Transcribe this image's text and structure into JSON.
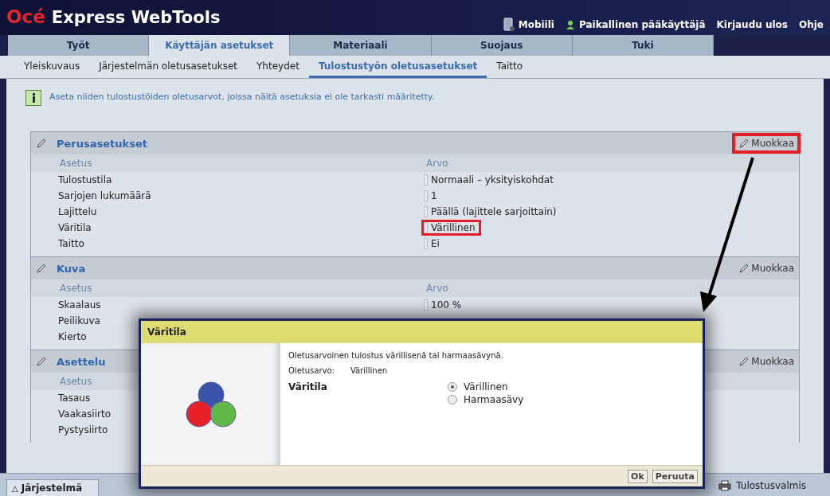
{
  "header": {
    "logo_brand": "Océ",
    "logo_product": "Express WebTools",
    "links": [
      {
        "kind": "mobile",
        "label": "Mobiili"
      },
      {
        "kind": "user",
        "label": "Paikallinen pääkäyttäjä"
      },
      {
        "kind": "plain",
        "label": "Kirjaudu ulos"
      },
      {
        "kind": "plain",
        "label": "Ohje"
      }
    ]
  },
  "tabs": [
    {
      "label": "Työt",
      "selected": false
    },
    {
      "label": "Käyttäjän asetukset",
      "selected": true
    },
    {
      "label": "Materiaali",
      "selected": false
    },
    {
      "label": "Suojaus",
      "selected": false
    },
    {
      "label": "Tuki",
      "selected": false
    }
  ],
  "subtabs": [
    {
      "label": "Yleiskuvaus",
      "selected": false
    },
    {
      "label": "Järjestelmän oletusasetukset",
      "selected": false
    },
    {
      "label": "Yhteydet",
      "selected": false
    },
    {
      "label": "Tulostustyön oletusasetukset",
      "selected": true
    },
    {
      "label": "Taitto",
      "selected": false
    }
  ],
  "info": "Aseta niiden tulostustöiden oletusarvot, joissa näitä asetuksia ei ole tarkasti määritetty.",
  "sections": [
    {
      "title": "Perusasetukset",
      "edit_label": "Muokkaa",
      "highlighted": true,
      "columns": [
        "Asetus",
        "Arvo"
      ],
      "rows": [
        {
          "setting": "Tulostustila",
          "value": "Normaali – yksityiskohdat",
          "highlighted": false
        },
        {
          "setting": "Sarjojen lukumäärä",
          "value": "1",
          "highlighted": false
        },
        {
          "setting": "Lajittelu",
          "value": "Päällä (lajittele sarjoittain)",
          "highlighted": false
        },
        {
          "setting": "Väritila",
          "value": "Värillinen",
          "highlighted": true
        },
        {
          "setting": "Taitto",
          "value": "Ei",
          "highlighted": false
        }
      ]
    },
    {
      "title": "Kuva",
      "edit_label": "Muokkaa",
      "highlighted": false,
      "columns": [
        "Asetus",
        "Arvo"
      ],
      "rows": [
        {
          "setting": "Skaalaus",
          "value": "100 %",
          "highlighted": false
        },
        {
          "setting": "Peilikuva",
          "highlighted": false
        },
        {
          "setting": "Kierto",
          "highlighted": false
        }
      ]
    },
    {
      "title": "Asettelu",
      "edit_label": "Muokkaa",
      "highlighted": false,
      "columns": [
        "Asetus"
      ],
      "rows": [
        {
          "setting": "Tasaus",
          "highlighted": false
        },
        {
          "setting": "Vaakasiirto",
          "highlighted": false
        },
        {
          "setting": "Pystysiirto",
          "highlighted": false
        }
      ]
    }
  ],
  "dialog": {
    "title": "Väritila",
    "description": "Oletusarvoinen tulostus värillisenä tai harmaasävynä.",
    "default_label": "Oletusarvo:",
    "default_value": "Värillinen",
    "field_label": "Väritila",
    "options": [
      {
        "label": "Värillinen",
        "selected": true
      },
      {
        "label": "Harmaasävy",
        "selected": false
      }
    ],
    "buttons": [
      "Ok",
      "Peruuta"
    ]
  },
  "status_bar": {
    "tab_icon": "△",
    "tab": "Järjestelmä",
    "status": "Tulostusvalmis"
  }
}
